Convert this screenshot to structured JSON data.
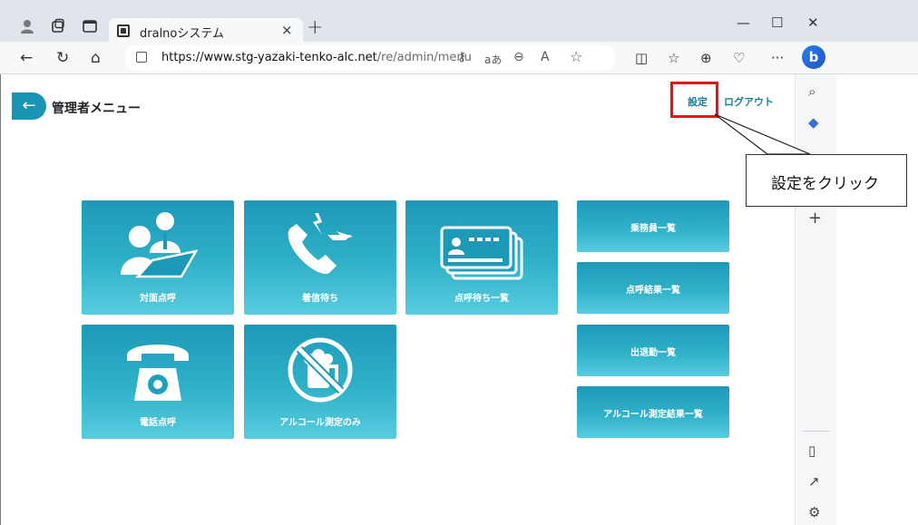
{
  "browser": {
    "tab_title": "dralnoシステム",
    "tab_close": "×",
    "new_tab": "+",
    "url_host": "https://www.stg-yazaki-tenko-alc.net",
    "url_path": "/re/admin/menu",
    "read_aloud_label": "aあ",
    "window_min": "—",
    "window_max": "☐",
    "window_close": "✕"
  },
  "header": {
    "back_icon": "←",
    "title": "管理者メニュー",
    "settings_label": "設定",
    "logout_label": "ログアウト"
  },
  "tiles": [
    {
      "id": "face-to-face",
      "label": "対面点呼",
      "icon": "person-desk-icon"
    },
    {
      "id": "incoming",
      "label": "着信待ち",
      "icon": "incoming-call-icon"
    },
    {
      "id": "waiting-list",
      "label": "点呼待ち一覧",
      "icon": "id-cards-icon"
    },
    {
      "id": "phone-rollcall",
      "label": "電話点呼",
      "icon": "telephone-icon"
    },
    {
      "id": "alcohol-only",
      "label": "アルコール測定のみ",
      "icon": "no-drinking-icon"
    }
  ],
  "side_tiles": [
    {
      "id": "crew-list",
      "label": "乗務員一覧"
    },
    {
      "id": "rollcall-results",
      "label": "点呼結果一覧"
    },
    {
      "id": "attendance-list",
      "label": "出退勤一覧"
    },
    {
      "id": "alcohol-results",
      "label": "アルコール測定結果一覧"
    }
  ],
  "annotation": {
    "text": "設定をクリック",
    "color": "#e11111"
  },
  "colors": {
    "tile_top": "#1d99b8",
    "tile_bottom": "#58cce0",
    "accent": "#1a94b5"
  }
}
